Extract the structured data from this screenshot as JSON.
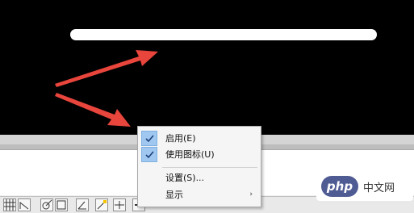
{
  "context_menu": {
    "items": [
      {
        "label": "启用(E)",
        "checked": true
      },
      {
        "label": "使用图标(U)",
        "checked": true
      },
      {
        "label": "设置(S)...",
        "checked": false
      },
      {
        "label": "显示",
        "checked": false,
        "submenu": true
      }
    ],
    "submenu_arrow": "›"
  },
  "watermark": {
    "logo_text": "php",
    "site_text": "中文网"
  },
  "colors": {
    "annotation_arrow": "#e8453c",
    "check_highlight": "#9fc7f0",
    "canvas": "#000000"
  }
}
